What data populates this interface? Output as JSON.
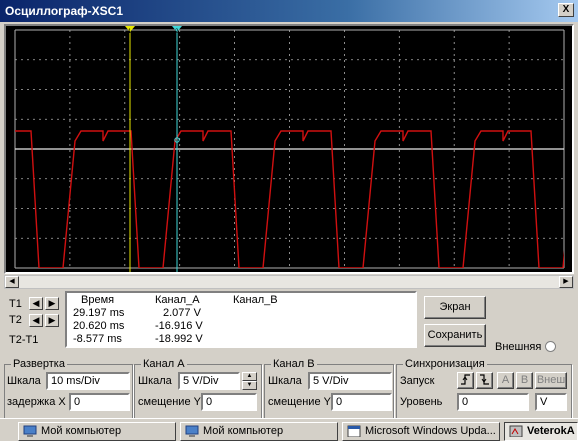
{
  "window": {
    "title": "Осциллограф-XSC1",
    "close_glyph": "X"
  },
  "scope": {
    "background": "#000000",
    "grid_color": "#b0b0b0",
    "trace_a_color": "#d01010",
    "trace_b_color": "#e8e8e8",
    "cursor1_color": "#e8e800",
    "cursor2_color": "#40d8d8",
    "cursor1_label": "1",
    "cursor2_label": "2"
  },
  "cursors": {
    "rows": [
      {
        "label": "T1",
        "time": "29.197 ms",
        "ch_a": "2.077 V",
        "ch_b": ""
      },
      {
        "label": "T2",
        "time": "20.620 ms",
        "ch_a": "-16.916 V",
        "ch_b": ""
      },
      {
        "label": "T2-T1",
        "time": "-8.577 ms",
        "ch_a": "-18.992 V",
        "ch_b": ""
      }
    ],
    "headers": {
      "time": "Время",
      "ch_a": "Канал_А",
      "ch_b": "Канал_В"
    }
  },
  "buttons": {
    "screen": "Экран",
    "save": "Сохранить"
  },
  "external": {
    "label": "Внешняя"
  },
  "timebase": {
    "title": "Развертка",
    "scale_label": "Шкала",
    "scale_value": "10 ms/Div",
    "delay_label": "задержка Х",
    "delay_value": "0"
  },
  "channel_a": {
    "title": "Канал А",
    "scale_label": "Шкала",
    "scale_value": "5  V/Div",
    "offset_label": "смещение Y",
    "offset_value": "0"
  },
  "channel_b": {
    "title": "Канал В",
    "scale_label": "Шкала",
    "scale_value": "5  V/Div",
    "offset_label": "смещение Y",
    "offset_value": "0"
  },
  "trigger": {
    "title": "Синхронизация",
    "start_label": "Запуск",
    "level_label": "Уровень",
    "level_value": "0",
    "unit_value": "V",
    "src_a": "A",
    "src_b": "B",
    "src_ext": "Внеш"
  },
  "taskbar": {
    "items": [
      {
        "label": "Мой компьютер"
      },
      {
        "label": "Мой компьютер"
      },
      {
        "label": "Microsoft Windows Upda..."
      },
      {
        "label": "VeterokA"
      }
    ]
  }
}
